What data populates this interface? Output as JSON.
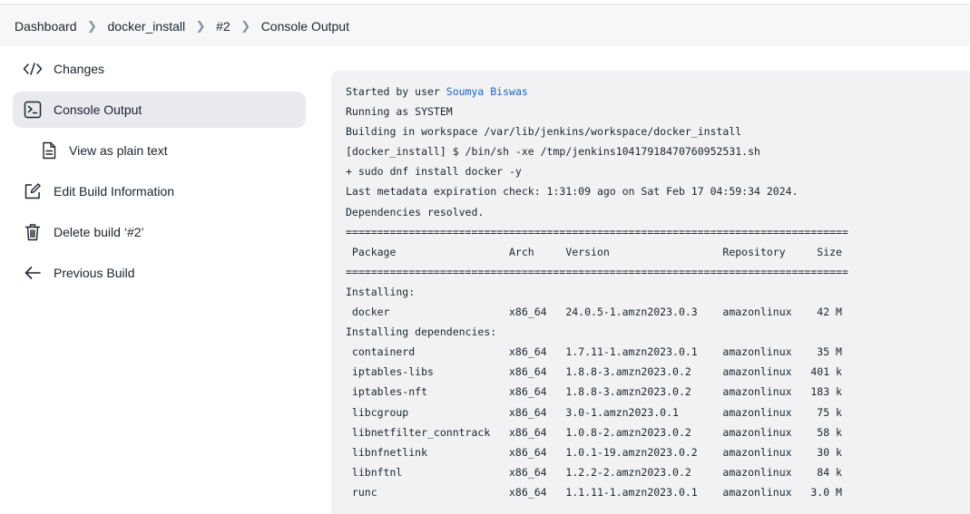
{
  "breadcrumb": [
    "Dashboard",
    "docker_install",
    "#2",
    "Console Output"
  ],
  "sidebar": {
    "items": [
      {
        "label": "Changes",
        "icon": "code-icon"
      },
      {
        "label": "Console Output",
        "icon": "terminal-icon",
        "active": true
      },
      {
        "label": "View as plain text",
        "icon": "document-icon",
        "sub": true
      },
      {
        "label": "Edit Build Information",
        "icon": "edit-icon"
      },
      {
        "label": "Delete build ‘#2’",
        "icon": "trash-icon"
      },
      {
        "label": "Previous Build",
        "icon": "arrow-left-icon"
      }
    ]
  },
  "console": {
    "started_by": "Started by user ",
    "user": "Soumya Biswas",
    "lines": [
      "Running as SYSTEM",
      "Building in workspace /var/lib/jenkins/workspace/docker_install",
      "[docker_install] $ /bin/sh -xe /tmp/jenkins10417918470760952531.sh",
      "+ sudo dnf install docker -y",
      "Last metadata expiration check: 1:31:09 ago on Sat Feb 17 04:59:34 2024.",
      "Dependencies resolved.",
      "================================================================================",
      " Package                  Arch     Version                  Repository     Size",
      "================================================================================",
      "Installing:",
      " docker                   x86_64   24.0.5-1.amzn2023.0.3    amazonlinux    42 M",
      "Installing dependencies:",
      " containerd               x86_64   1.7.11-1.amzn2023.0.1    amazonlinux    35 M",
      " iptables-libs            x86_64   1.8.8-3.amzn2023.0.2     amazonlinux   401 k",
      " iptables-nft             x86_64   1.8.8-3.amzn2023.0.2     amazonlinux   183 k",
      " libcgroup                x86_64   3.0-1.amzn2023.0.1       amazonlinux    75 k",
      " libnetfilter_conntrack   x86_64   1.0.8-2.amzn2023.0.2     amazonlinux    58 k",
      " libnfnetlink             x86_64   1.0.1-19.amzn2023.0.2    amazonlinux    30 k",
      " libnftnl                 x86_64   1.2.2-2.amzn2023.0.2     amazonlinux    84 k",
      " runc                     x86_64   1.1.11-1.amzn2023.0.1    amazonlinux   3.0 M"
    ]
  }
}
